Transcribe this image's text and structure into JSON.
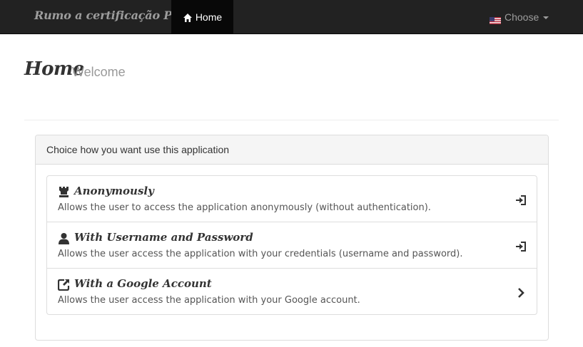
{
  "navbar": {
    "brand": "Rumo a certificação PHP",
    "home_label": "Home",
    "language": {
      "label": "Choose",
      "flag": "us-flag-icon"
    }
  },
  "header": {
    "title": "Home",
    "subtitle": "Welcome"
  },
  "panel": {
    "heading": "Choice how you want use this application",
    "items": [
      {
        "icon": "chess-rook-icon",
        "title": "Anonymously",
        "description": "Allows the user to access the application anonymously (without authentication).",
        "action_icon": "log-in-icon"
      },
      {
        "icon": "user-icon",
        "title": "With Username and Password",
        "description": "Allows the user access the application with your credentials (username and password).",
        "action_icon": "log-in-icon"
      },
      {
        "icon": "share-icon",
        "title": "With a Google Account",
        "description": "Allows the user access the application with your Google account.",
        "action_icon": "chevron-right-icon"
      }
    ]
  },
  "colors": {
    "navbar_bg": "#222222",
    "navbar_active": "#080808",
    "navbar_text": "#9d9d9d",
    "border": "#dddddd",
    "panel_heading_bg": "#f5f5f5"
  }
}
